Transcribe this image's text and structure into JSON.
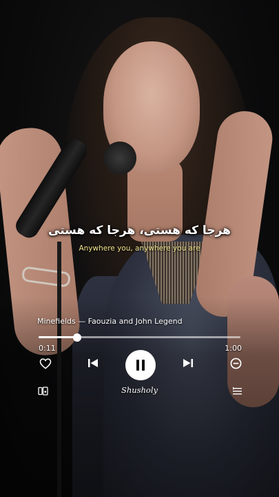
{
  "lyrics": {
    "primary": "هرجا که هستی، هرجا که هستی",
    "translation": "Anywhere you, anywhere you are"
  },
  "player": {
    "track_title": "Minefields — Faouzia and John Legend",
    "elapsed": "0:11",
    "duration": "1:00",
    "progress_fraction": 0.19,
    "brand": "Shusholy"
  },
  "icons": {
    "like": "heart-icon",
    "previous": "skip-previous-icon",
    "play_pause": "pause-icon",
    "next": "skip-next-icon",
    "remove": "minus-circle-icon",
    "device": "devices-icon",
    "queue": "queue-icon"
  },
  "colors": {
    "translation_text": "#f0e38a",
    "play_button": "#ffffff"
  }
}
